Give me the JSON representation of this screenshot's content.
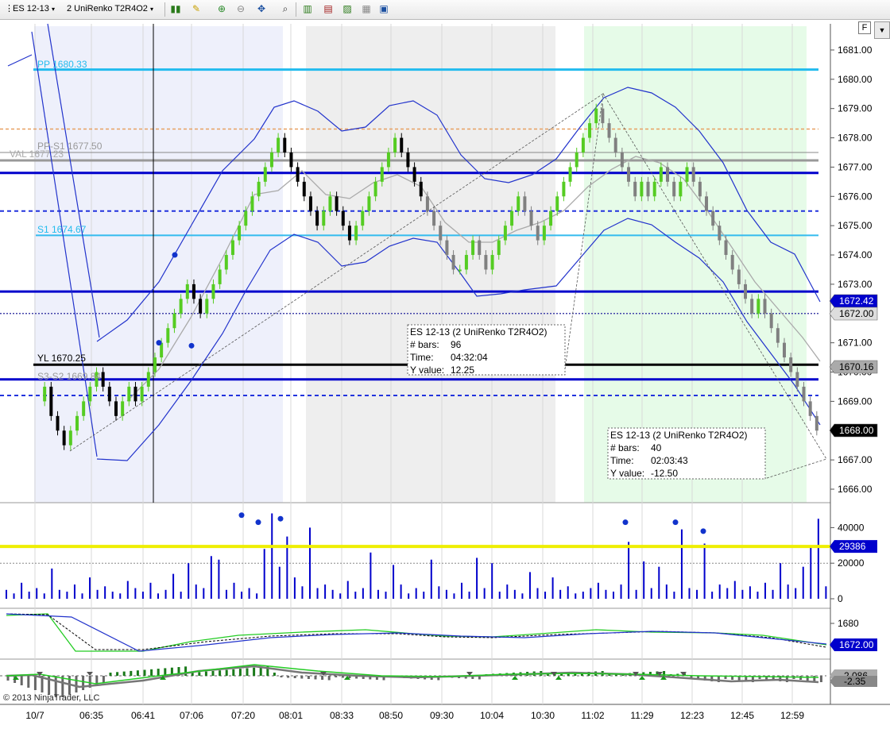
{
  "toolbar": {
    "instrument": "ES 12-13",
    "period": "2 UniRenko T2R4O2",
    "f_button": "F",
    "icons": [
      "bar-style-icon",
      "draw-pencil-icon",
      "zoom-in-icon",
      "zoom-out-icon",
      "crosshair-icon",
      "search-icon",
      "chart-trader-icon",
      "indicators-icon",
      "strategies-icon",
      "properties-icon"
    ]
  },
  "copyright": "© 2013 NinjaTrader, LLC",
  "colors": {
    "up_bar": "#55cc22",
    "down_bar_black": "#000000",
    "down_bar_gray": "#808080",
    "pivot_cyan": "#22bbee",
    "blue_line": "#0000cc",
    "yellow_line": "#eeee00",
    "band": "#2233cc",
    "sma": "#aaaaaa"
  },
  "chart_data": [
    {
      "type": "candlestick",
      "title": "ES 12-13 (2 UniRenko T2R4O2)",
      "x_tick_labels": [
        "10/7",
        "06:35",
        "06:41",
        "07:06",
        "07:20",
        "08:01",
        "08:33",
        "08:50",
        "09:30",
        "10:04",
        "10:30",
        "11:02",
        "11:29",
        "12:23",
        "12:45",
        "12:59"
      ],
      "ylim": [
        1665.5,
        1681.5
      ],
      "y_ticks": [
        1666,
        1667,
        1668,
        1669,
        1670,
        1671,
        1672,
        1673,
        1674,
        1675,
        1676,
        1677,
        1678,
        1679,
        1680,
        1681
      ],
      "y_tick_labels": [
        "1666.00",
        "1667.00",
        "1668.00",
        "1669.00",
        "1670.00",
        "1671.00",
        "1672.00",
        "1673.00",
        "1674.00",
        "1675.00",
        "1676.00",
        "1677.00",
        "1678.00",
        "1679.00",
        "1680.00",
        "1681.00"
      ],
      "closes": [
        1669.0,
        1669.5,
        1668.5,
        1668.0,
        1667.5,
        1668.0,
        1668.5,
        1669.0,
        1669.5,
        1670.0,
        1669.5,
        1669.0,
        1668.5,
        1669.0,
        1669.5,
        1669.0,
        1669.5,
        1670.0,
        1670.5,
        1671.0,
        1671.5,
        1672.0,
        1672.5,
        1673.0,
        1672.5,
        1672.0,
        1672.5,
        1673.0,
        1673.5,
        1674.0,
        1674.5,
        1675.0,
        1675.5,
        1676.0,
        1676.5,
        1677.0,
        1677.5,
        1678.0,
        1677.5,
        1677.0,
        1676.5,
        1676.0,
        1675.5,
        1675.0,
        1675.5,
        1676.0,
        1675.5,
        1675.0,
        1674.5,
        1675.0,
        1675.5,
        1676.0,
        1676.5,
        1677.0,
        1677.5,
        1678.0,
        1677.5,
        1677.0,
        1676.5,
        1676.0,
        1675.5,
        1675.0,
        1674.5,
        1674.0,
        1673.5,
        1673.5,
        1674.0,
        1674.5,
        1674.0,
        1673.5,
        1674.0,
        1674.5,
        1675.0,
        1675.5,
        1676.0,
        1675.5,
        1675.0,
        1674.5,
        1675.0,
        1675.5,
        1676.0,
        1676.5,
        1677.0,
        1677.5,
        1678.0,
        1678.5,
        1679.0,
        1678.5,
        1678.0,
        1677.5,
        1677.0,
        1676.5,
        1676.0,
        1676.5,
        1676.0,
        1676.5,
        1677.0,
        1676.5,
        1676.0,
        1676.5,
        1677.0,
        1676.5,
        1676.0,
        1675.5,
        1675.0,
        1674.5,
        1674.0,
        1673.5,
        1673.0,
        1672.5,
        1672.0,
        1672.5,
        1672.0,
        1671.5,
        1671.0,
        1670.5,
        1670.0,
        1669.5,
        1669.0,
        1668.5,
        1668.0
      ],
      "markers_above": [
        1674.0
      ],
      "markers_below": [
        1671.0,
        1670.9
      ],
      "annotations": [
        {
          "label": "PP",
          "value": "1680.33"
        },
        {
          "label": "PP-S1",
          "value": "1677.50"
        },
        {
          "label": "VAL",
          "value": "1677.23"
        },
        {
          "label": "S1",
          "value": "1674.67"
        },
        {
          "label": "YL",
          "value": "1670.25"
        },
        {
          "label": "S3-S2",
          "value": "1669.84"
        }
      ],
      "horizontal_lines": [
        1680.33,
        1678.3,
        1677.5,
        1677.23,
        1676.8,
        1675.5,
        1674.67,
        1672.75,
        1672.0,
        1670.25,
        1669.75,
        1669.2
      ],
      "price_markers": [
        "1672.42",
        "1672.00",
        "1670.16",
        "1668.00"
      ],
      "measure_boxes": [
        {
          "title": "ES 12-13 (2 UniRenko T2R4O2)",
          "bars_label": "# bars:",
          "bars": "96",
          "time_label": "Time:",
          "time": "04:32:04",
          "y_label": "Y value:",
          "y": "12.25"
        },
        {
          "title": "ES 12-13 (2 UniRenko T2R4O2)",
          "bars_label": "# bars:",
          "bars": "40",
          "time_label": "Time:",
          "time": "02:03:43",
          "y_label": "Y value:",
          "y": "-12.50"
        }
      ]
    },
    {
      "type": "bar",
      "title": "",
      "ylim": [
        0,
        50000
      ],
      "y_tick_labels": [
        "40000",
        "20000",
        "0"
      ],
      "threshold": 29386,
      "threshold_label": "29386",
      "values": [
        5000,
        3000,
        9000,
        4000,
        6000,
        3000,
        17000,
        5000,
        4000,
        8000,
        3000,
        12000,
        5000,
        7000,
        4000,
        3000,
        10000,
        6000,
        4000,
        9000,
        3000,
        5000,
        14000,
        4000,
        20000,
        8000,
        6000,
        24000,
        22000,
        5000,
        9000,
        4000,
        6000,
        3000,
        28000,
        48000,
        18000,
        35000,
        12000,
        7000,
        40000,
        6000,
        8000,
        5000,
        3000,
        10000,
        4000,
        6000,
        26000,
        5000,
        4000,
        19000,
        8000,
        3000,
        6000,
        4000,
        22000,
        7000,
        5000,
        3000,
        9000,
        4000,
        23000,
        6000,
        20000,
        4000,
        8000,
        5000,
        3000,
        15000,
        6000,
        4000,
        12000,
        5000,
        7000,
        3000,
        4000,
        6000,
        9000,
        5000,
        4000,
        8000,
        32000,
        5000,
        21000,
        6000,
        18000,
        8000,
        4000,
        39000,
        6000,
        5000,
        31000,
        4000,
        8000,
        6000,
        10000,
        5000,
        7000,
        4000,
        9000,
        5000,
        20000,
        8000,
        6000,
        18000,
        30000,
        45000,
        7000
      ],
      "dots": [
        47000,
        43000,
        45000,
        43000,
        43000,
        38000
      ]
    },
    {
      "type": "line",
      "title": "",
      "y_tick_labels": [
        "1680"
      ],
      "marker_label": "1672.00"
    },
    {
      "type": "bar",
      "title": "",
      "marker_labels": [
        "-2.086",
        "-2.35"
      ]
    }
  ]
}
